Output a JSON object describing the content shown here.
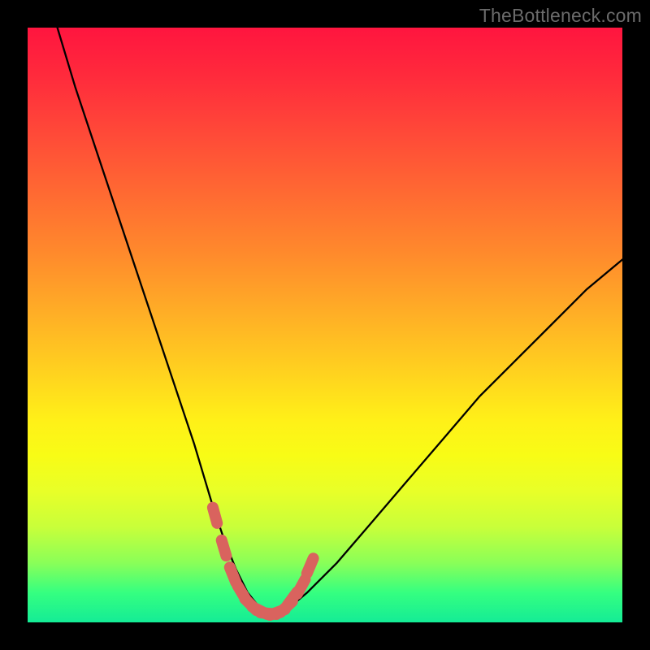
{
  "watermark": "TheBottleneck.com",
  "colors": {
    "background": "#000000",
    "curve": "#000000",
    "marker": "#d9635e",
    "gradient_stops": [
      "#ff153f",
      "#ff4a38",
      "#ff8a2c",
      "#ffd21f",
      "#f8fc16",
      "#c8ff3a",
      "#35ff80",
      "#14ec96"
    ]
  },
  "chart_data": {
    "type": "line",
    "title": "",
    "xlabel": "",
    "ylabel": "",
    "xlim": [
      0,
      100
    ],
    "ylim": [
      0,
      100
    ],
    "grid": false,
    "legend": false,
    "series": [
      {
        "name": "curve",
        "x": [
          5,
          8,
          12,
          16,
          20,
          24,
          28,
          31,
          33,
          35,
          37,
          39,
          40.5,
          42,
          44,
          47,
          52,
          58,
          64,
          70,
          76,
          82,
          88,
          94,
          100
        ],
        "y": [
          100,
          90,
          78,
          66,
          54,
          42,
          30,
          20,
          14,
          9,
          5,
          2.5,
          1.5,
          1.5,
          2.5,
          5,
          10,
          17,
          24,
          31,
          38,
          44,
          50,
          56,
          61
        ]
      }
    ],
    "markers": {
      "name": "highlighted-band",
      "x": [
        31.5,
        33.0,
        34.5,
        36.0,
        37.5,
        39.0,
        40.5,
        42.0,
        43.5,
        44.5,
        46.0,
        47.5
      ],
      "y": [
        18.0,
        12.5,
        8.0,
        5.0,
        3.0,
        2.0,
        1.5,
        1.7,
        2.6,
        4.0,
        6.0,
        9.5
      ]
    }
  }
}
